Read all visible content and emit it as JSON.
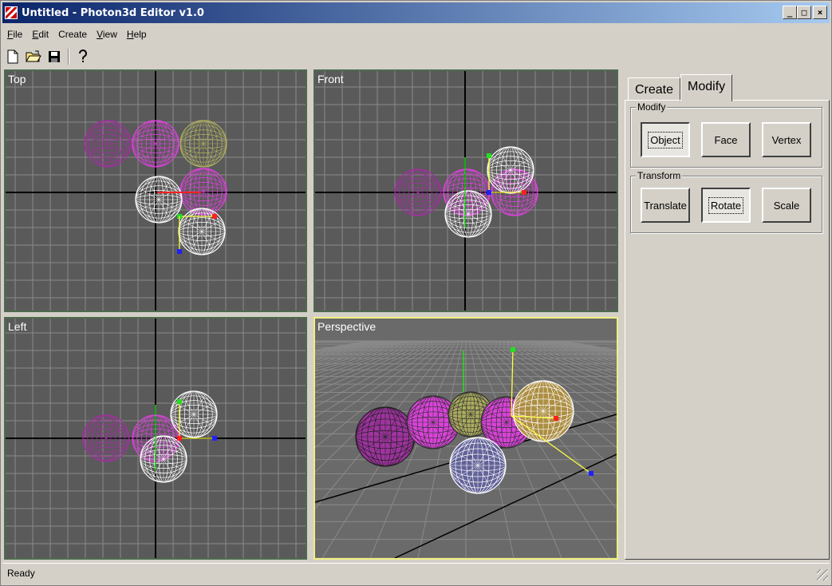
{
  "window": {
    "title": "Untitled - Photon3d Editor v1.0",
    "controls": {
      "minimize": "_",
      "maximize": "□",
      "close": "×"
    }
  },
  "menu": [
    {
      "accel": "F",
      "rest": "ile"
    },
    {
      "accel": "E",
      "rest": "dit"
    },
    {
      "accel": "C",
      "rest": "reate",
      "plain": true
    },
    {
      "accel": "V",
      "rest": "iew"
    },
    {
      "accel": "H",
      "rest": "elp"
    }
  ],
  "toolbar": {
    "icons": [
      "new-document-icon",
      "open-folder-icon",
      "save-disk-icon",
      "help-question-icon"
    ]
  },
  "viewports": {
    "top": {
      "label": "Top"
    },
    "front": {
      "label": "Front"
    },
    "left": {
      "label": "Left"
    },
    "perspective": {
      "label": "Perspective"
    }
  },
  "colors": {
    "viewport_bg": "#5a5a5a",
    "grid": "#8a8a8a",
    "axis": "#000000",
    "magenta": "#e040e0",
    "dark_magenta": "#a030a0",
    "olive": "#b0b060",
    "white": "#ffffff",
    "gizmo_x": "#ff2020",
    "gizmo_y": "#20e020",
    "gizmo_z": "#2020ff",
    "gizmo_line": "#ffff40"
  },
  "panel": {
    "tabs": {
      "create": "Create",
      "modify": "Modify"
    },
    "modify_group": {
      "title": "Modify",
      "buttons": {
        "object": "Object",
        "face": "Face",
        "vertex": "Vertex"
      }
    },
    "transform_group": {
      "title": "Transform",
      "buttons": {
        "translate": "Translate",
        "rotate": "Rotate",
        "scale": "Scale"
      }
    }
  },
  "status": {
    "text": "Ready"
  }
}
